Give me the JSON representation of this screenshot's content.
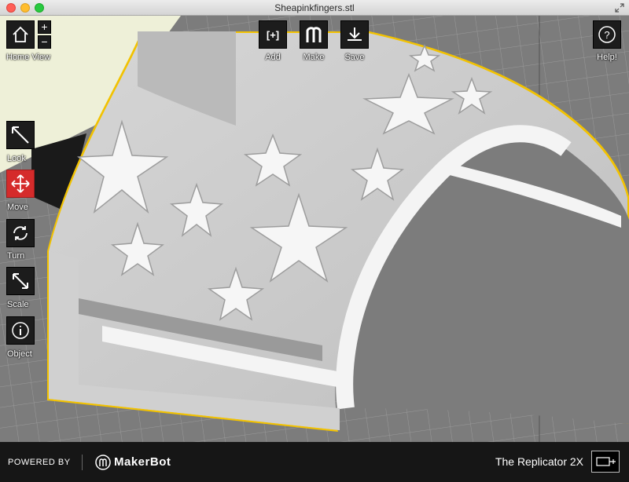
{
  "window": {
    "title": "Sheapinkfingers.stl"
  },
  "toolbar": {
    "home_view": "Home View",
    "zoom_in": "+",
    "zoom_out": "−",
    "add": "Add",
    "add_icon_text": "[+]",
    "make": "Make",
    "save": "Save",
    "help": "Help!",
    "help_icon_text": "?"
  },
  "side_tools": [
    {
      "label": "Look",
      "icon": "look-icon",
      "active": false
    },
    {
      "label": "Move",
      "icon": "move-icon",
      "active": true
    },
    {
      "label": "Turn",
      "icon": "turn-icon",
      "active": false
    },
    {
      "label": "Scale",
      "icon": "scale-icon",
      "active": false
    },
    {
      "label": "Object",
      "icon": "object-icon",
      "active": false
    }
  ],
  "footer": {
    "powered_by": "POWERED BY",
    "brand": "MakerBot",
    "printer": "The Replicator 2X"
  },
  "colors": {
    "active_tool": "#d52b2b",
    "selection_outline": "#f2c200",
    "model": "#e6e6e6",
    "build_plate": "#7c7c7c"
  }
}
